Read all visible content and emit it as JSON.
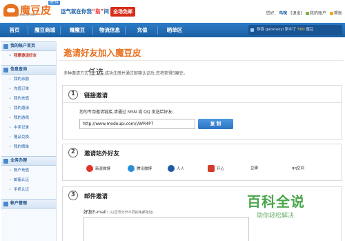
{
  "header": {
    "logo_text": "魔豆皮",
    "logo_sub": "modoupi.com",
    "beta": "BETA",
    "slogan_prefix": "运气就在你我",
    "slogan_highlight": "“指”",
    "slogan_suffix": "间",
    "free_badge": "全场免邮",
    "greeting": "您好,",
    "username": "鸟咪",
    "logout": "[退出]",
    "my_account": "我的账户",
    "help": "帮助"
  },
  "nav": {
    "items": [
      "首页",
      "魔豆商城",
      "赚魔豆",
      "物流信息",
      "充值",
      "晒单区"
    ],
    "ticker_prefix": "恭喜",
    "ticker_user": "gaoxiaoyi",
    "ticker_middle": "刚中了",
    "ticker_amount": "500",
    "ticker_suffix": "魔豆"
  },
  "sidebar": {
    "sections": [
      {
        "title": "我的账户首页",
        "items": [
          {
            "label": "我要邀请好友",
            "active": true
          }
        ]
      },
      {
        "title": "信息查询",
        "items": [
          {
            "label": "我的余额"
          },
          {
            "label": "充值订单"
          },
          {
            "label": "我的充值"
          },
          {
            "label": "我的邀请"
          },
          {
            "label": "我的游戏"
          },
          {
            "label": "中奖记录"
          },
          {
            "label": "赠品兑换"
          },
          {
            "label": "我的晒单"
          }
        ]
      },
      {
        "title": "业务办理",
        "items": [
          {
            "label": "账户充值"
          },
          {
            "label": "邮箱认证"
          },
          {
            "label": "手机认证"
          }
        ]
      },
      {
        "title": "帐户管理",
        "items": []
      }
    ]
  },
  "main": {
    "title": "邀请好友加入魔豆皮",
    "intro_prefix": "多种邀请方式",
    "intro_big": "任选",
    "intro_suffix": ",成功注册并通过邮箱认证后,您将获得5魔豆。",
    "step1": {
      "num": "1",
      "title": "链接邀请",
      "label": "您的专用邀请链接,请通过 MSN 或 QQ 发送给好友:",
      "link": "http://www.modoupi.com/i/WR4P7",
      "copy_button": "复 制"
    },
    "step2": {
      "num": "2",
      "title": "邀请站外好友",
      "shares": [
        {
          "label": "新浪微博",
          "color": "#e0342b"
        },
        {
          "label": "腾讯微博",
          "color": "#2a8fd6"
        },
        {
          "label": "人人",
          "color": "#1f5aa6"
        },
        {
          "label": "开心",
          "color": "#d43b2a"
        },
        {
          "label": "豆瓣",
          "color": "#4b9a4b"
        },
        {
          "label": "qq空间",
          "color": "#f0a823"
        }
      ]
    },
    "step3": {
      "num": "3",
      "title": "邮件邀请",
      "label": "好友E-mail:",
      "hint": "(以逗号分开不同的电邮地址)"
    }
  },
  "watermark": {
    "main": "百科全说",
    "sub": "助你轻松解决"
  }
}
